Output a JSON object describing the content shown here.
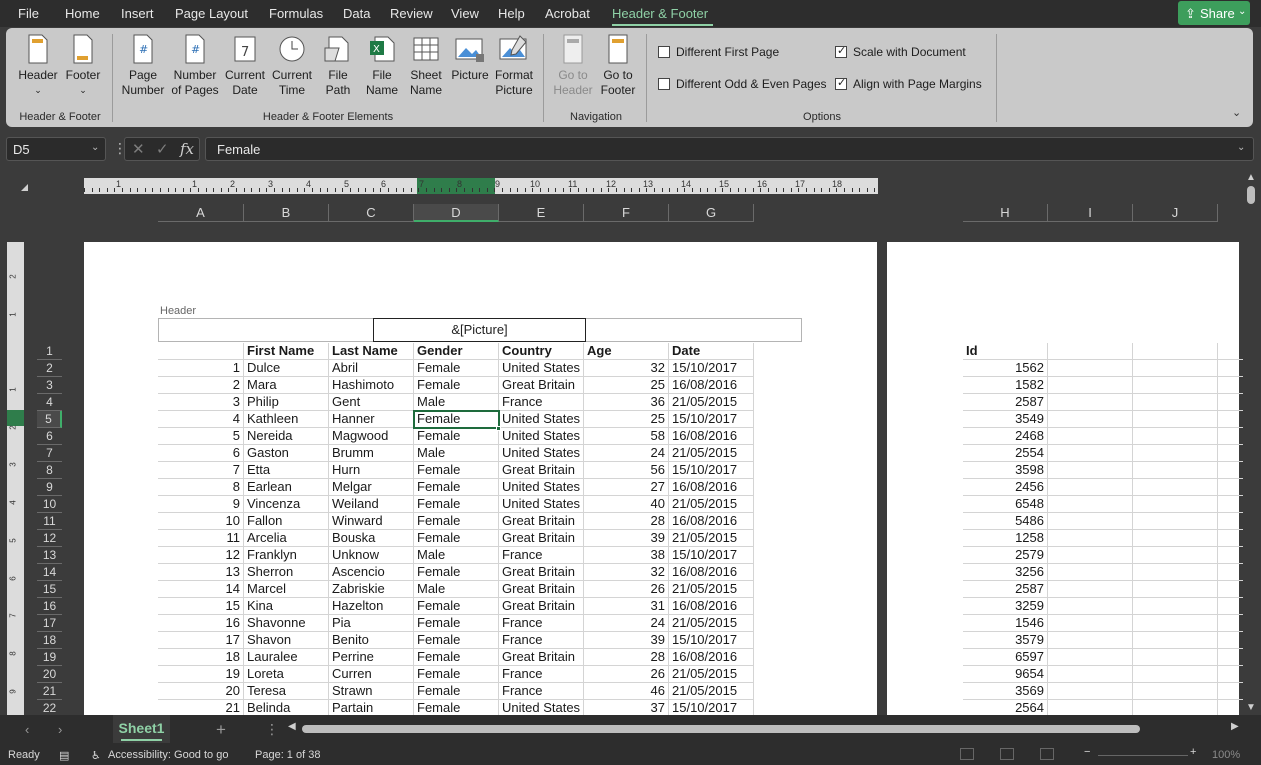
{
  "menu": {
    "items": [
      "File",
      "Home",
      "Insert",
      "Page Layout",
      "Formulas",
      "Data",
      "Review",
      "View",
      "Help",
      "Acrobat",
      "Header & Footer"
    ],
    "active": "Header & Footer",
    "share_label": "Share"
  },
  "ribbon": {
    "groups": {
      "header_footer": "Header & Footer",
      "elements": "Header & Footer Elements",
      "navigation": "Navigation",
      "options": "Options"
    },
    "buttons": {
      "header": "Header",
      "footer": "Footer",
      "page_number_1": "Page",
      "page_number_2": "Number",
      "num_pages_1": "Number",
      "num_pages_2": "of Pages",
      "cur_date_1": "Current",
      "cur_date_2": "Date",
      "cur_time_1": "Current",
      "cur_time_2": "Time",
      "file_path_1": "File",
      "file_path_2": "Path",
      "file_name_1": "File",
      "file_name_2": "Name",
      "sheet_name_1": "Sheet",
      "sheet_name_2": "Name",
      "picture": "Picture",
      "format_pic_1": "Format",
      "format_pic_2": "Picture",
      "goto_header_1": "Go to",
      "goto_header_2": "Header",
      "goto_footer_1": "Go to",
      "goto_footer_2": "Footer"
    },
    "options": {
      "diff_first": {
        "label": "Different First Page",
        "checked": false
      },
      "diff_odd_even": {
        "label": "Different Odd & Even Pages",
        "checked": false
      },
      "scale_doc": {
        "label": "Scale with Document",
        "checked": true
      },
      "align_margins": {
        "label": "Align with Page Margins",
        "checked": true
      }
    }
  },
  "formula_bar": {
    "name_box": "D5",
    "value": "Female",
    "fx": "fx"
  },
  "sheet": {
    "columns_left": [
      "A",
      "B",
      "C",
      "D",
      "E",
      "F",
      "G"
    ],
    "columns_right": [
      "H",
      "I",
      "J"
    ],
    "selected_column": "D",
    "rows": [
      "1",
      "2",
      "3",
      "4",
      "5",
      "6",
      "7",
      "8",
      "9",
      "10",
      "11",
      "12",
      "13",
      "14",
      "15",
      "16",
      "17",
      "18",
      "19",
      "20",
      "21",
      "22"
    ],
    "selected_row": "5",
    "header_label": "Header",
    "header_center_text": "&[Picture]",
    "headers": [
      "",
      "First Name",
      "Last Name",
      "Gender",
      "Country",
      "Age",
      "Date",
      "Id"
    ],
    "data": [
      [
        "1",
        "Dulce",
        "Abril",
        "Female",
        "United States",
        "32",
        "15/10/2017",
        "1562"
      ],
      [
        "2",
        "Mara",
        "Hashimoto",
        "Female",
        "Great Britain",
        "25",
        "16/08/2016",
        "1582"
      ],
      [
        "3",
        "Philip",
        "Gent",
        "Male",
        "France",
        "36",
        "21/05/2015",
        "2587"
      ],
      [
        "4",
        "Kathleen",
        "Hanner",
        "Female",
        "United States",
        "25",
        "15/10/2017",
        "3549"
      ],
      [
        "5",
        "Nereida",
        "Magwood",
        "Female",
        "United States",
        "58",
        "16/08/2016",
        "2468"
      ],
      [
        "6",
        "Gaston",
        "Brumm",
        "Male",
        "United States",
        "24",
        "21/05/2015",
        "2554"
      ],
      [
        "7",
        "Etta",
        "Hurn",
        "Female",
        "Great Britain",
        "56",
        "15/10/2017",
        "3598"
      ],
      [
        "8",
        "Earlean",
        "Melgar",
        "Female",
        "United States",
        "27",
        "16/08/2016",
        "2456"
      ],
      [
        "9",
        "Vincenza",
        "Weiland",
        "Female",
        "United States",
        "40",
        "21/05/2015",
        "6548"
      ],
      [
        "10",
        "Fallon",
        "Winward",
        "Female",
        "Great Britain",
        "28",
        "16/08/2016",
        "5486"
      ],
      [
        "11",
        "Arcelia",
        "Bouska",
        "Female",
        "Great Britain",
        "39",
        "21/05/2015",
        "1258"
      ],
      [
        "12",
        "Franklyn",
        "Unknow",
        "Male",
        "France",
        "38",
        "15/10/2017",
        "2579"
      ],
      [
        "13",
        "Sherron",
        "Ascencio",
        "Female",
        "Great Britain",
        "32",
        "16/08/2016",
        "3256"
      ],
      [
        "14",
        "Marcel",
        "Zabriskie",
        "Male",
        "Great Britain",
        "26",
        "21/05/2015",
        "2587"
      ],
      [
        "15",
        "Kina",
        "Hazelton",
        "Female",
        "Great Britain",
        "31",
        "16/08/2016",
        "3259"
      ],
      [
        "16",
        "Shavonne",
        "Pia",
        "Female",
        "France",
        "24",
        "21/05/2015",
        "1546"
      ],
      [
        "17",
        "Shavon",
        "Benito",
        "Female",
        "France",
        "39",
        "15/10/2017",
        "3579"
      ],
      [
        "18",
        "Lauralee",
        "Perrine",
        "Female",
        "Great Britain",
        "28",
        "16/08/2016",
        "6597"
      ],
      [
        "19",
        "Loreta",
        "Curren",
        "Female",
        "France",
        "26",
        "21/05/2015",
        "9654"
      ],
      [
        "20",
        "Teresa",
        "Strawn",
        "Female",
        "France",
        "46",
        "21/05/2015",
        "3569"
      ],
      [
        "21",
        "Belinda",
        "Partain",
        "Female",
        "United States",
        "37",
        "15/10/2017",
        "2564"
      ]
    ],
    "ruler_numbers": [
      "1",
      "1",
      "2",
      "3",
      "4",
      "5",
      "6",
      "7",
      "8",
      "9",
      "10",
      "11",
      "12",
      "13",
      "14",
      "15",
      "16",
      "17",
      "18"
    ],
    "vruler_numbers": [
      "2",
      "1",
      "1",
      "2",
      "3",
      "4",
      "5",
      "6",
      "7",
      "8",
      "9"
    ]
  },
  "tabs": {
    "sheet_name": "Sheet1"
  },
  "status": {
    "ready": "Ready",
    "accessibility": "Accessibility: Good to go",
    "page": "Page: 1 of 38",
    "zoom": "100%"
  }
}
